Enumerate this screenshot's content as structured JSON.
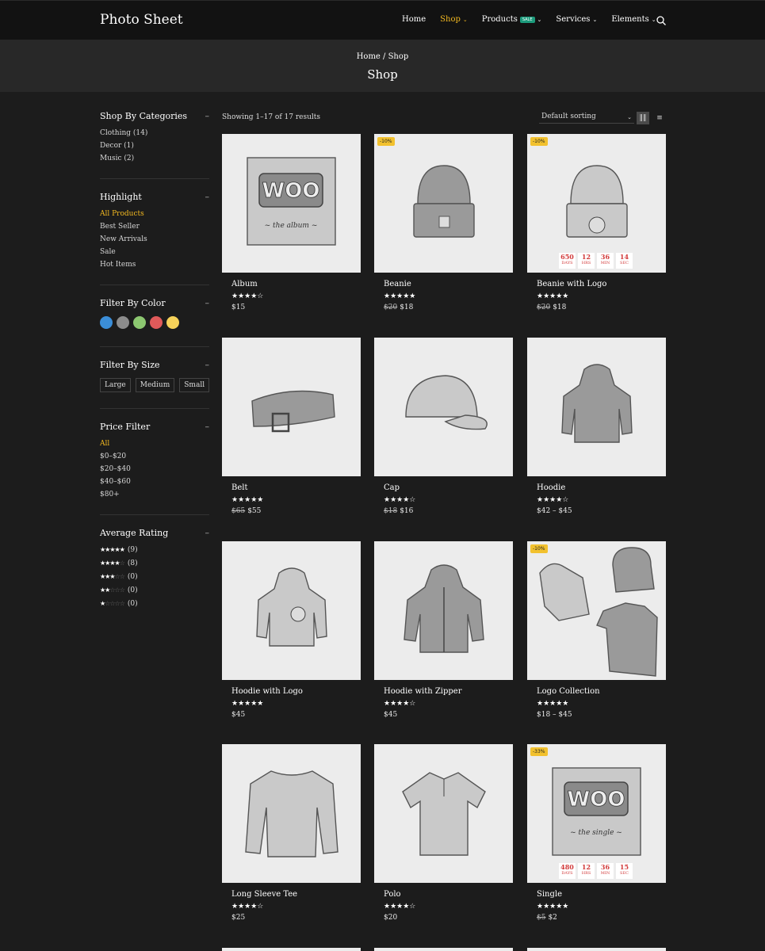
{
  "site": {
    "logo": "Photo Sheet"
  },
  "nav": {
    "items": [
      {
        "label": "Home",
        "active": false,
        "caret": false
      },
      {
        "label": "Shop",
        "active": true,
        "caret": true
      },
      {
        "label": "Products",
        "active": false,
        "caret": true,
        "badge": "SALE"
      },
      {
        "label": "Services",
        "active": false,
        "caret": true
      },
      {
        "label": "Elements",
        "active": false,
        "caret": true
      }
    ],
    "search_icon": "search-icon"
  },
  "hero": {
    "breadcrumb": "Home / Shop",
    "title": "Shop"
  },
  "sidebar": {
    "categories": {
      "title": "Shop By Categories",
      "items": [
        "Clothing (14)",
        "Decor (1)",
        "Music (2)"
      ]
    },
    "highlight": {
      "title": "Highlight",
      "items": [
        "All Products",
        "Best Seller",
        "New Arrivals",
        "Sale",
        "Hot Items"
      ],
      "selected": "All Products"
    },
    "color": {
      "title": "Filter By Color",
      "swatches": [
        "#3b8ed8",
        "#8c8c8c",
        "#8cc770",
        "#e05a5a",
        "#f6d25a"
      ]
    },
    "size": {
      "title": "Filter By Size",
      "items": [
        "Large",
        "Medium",
        "Small"
      ]
    },
    "price": {
      "title": "Price Filter",
      "items": [
        "All",
        "$0–$20",
        "$20–$40",
        "$40–$60",
        "$80+"
      ],
      "selected": "All"
    },
    "rating": {
      "title": "Average Rating",
      "rows": [
        {
          "stars": 5,
          "count": "(9)"
        },
        {
          "stars": 4,
          "count": "(8)"
        },
        {
          "stars": 3,
          "count": "(0)"
        },
        {
          "stars": 2,
          "count": "(0)"
        },
        {
          "stars": 1,
          "count": "(0)"
        }
      ]
    },
    "collapse_symbol": "–"
  },
  "toolbar": {
    "result_count": "Showing 1–17 of 17 results",
    "sorting": "Default sorting",
    "grid_icon": "grid-view-icon",
    "list_icon": "list-view-icon"
  },
  "products": [
    {
      "name": "Album",
      "rating": 4,
      "old_price": "",
      "price": "$15",
      "badge": "",
      "image": "album"
    },
    {
      "name": "Beanie",
      "rating": 5,
      "old_price": "$20",
      "price": "$18",
      "badge": "-10%",
      "image": "beanie"
    },
    {
      "name": "Beanie with Logo",
      "rating": 5,
      "old_price": "$20",
      "price": "$18",
      "badge": "-10%",
      "image": "beanie-logo",
      "countdown": [
        {
          "n": "650",
          "u": "DAYS"
        },
        {
          "n": "12",
          "u": "HRS"
        },
        {
          "n": "36",
          "u": "MIN"
        },
        {
          "n": "14",
          "u": "SEC"
        }
      ]
    },
    {
      "name": "Belt",
      "rating": 5,
      "old_price": "$65",
      "price": "$55",
      "badge": "",
      "image": "belt"
    },
    {
      "name": "Cap",
      "rating": 4,
      "old_price": "$18",
      "price": "$16",
      "badge": "",
      "image": "cap"
    },
    {
      "name": "Hoodie",
      "rating": 4,
      "old_price": "",
      "price": "$42 – $45",
      "badge": "",
      "image": "hoodie"
    },
    {
      "name": "Hoodie with Logo",
      "rating": 5,
      "old_price": "",
      "price": "$45",
      "badge": "",
      "image": "hoodie-logo"
    },
    {
      "name": "Hoodie with Zipper",
      "rating": 4,
      "old_price": "",
      "price": "$45",
      "badge": "",
      "image": "hoodie-zip"
    },
    {
      "name": "Logo Collection",
      "rating": 5,
      "old_price": "",
      "price": "$18 – $45",
      "badge": "-10%",
      "image": "collection"
    },
    {
      "name": "Long Sleeve Tee",
      "rating": 4,
      "old_price": "",
      "price": "$25",
      "badge": "",
      "image": "longsleeve"
    },
    {
      "name": "Polo",
      "rating": 4,
      "old_price": "",
      "price": "$20",
      "badge": "",
      "image": "polo"
    },
    {
      "name": "Single",
      "rating": 5,
      "old_price": "$5",
      "price": "$2",
      "badge": "-33%",
      "image": "single",
      "countdown": [
        {
          "n": "480",
          "u": "DAYS"
        },
        {
          "n": "12",
          "u": "HRS"
        },
        {
          "n": "36",
          "u": "MIN"
        },
        {
          "n": "15",
          "u": "SEC"
        }
      ]
    }
  ],
  "colors": {
    "accent": "#f2b820",
    "sale_badge": "#1c9b7c",
    "discount_badge": "#f2c12e",
    "countdown_text": "#d23a3a"
  }
}
